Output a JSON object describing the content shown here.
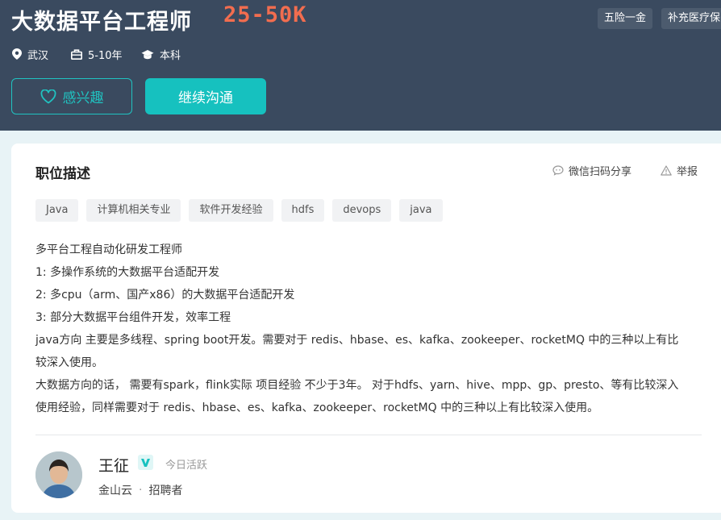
{
  "job": {
    "title": "大数据平台工程师",
    "salary": "25-50K",
    "benefits": [
      "五险一金",
      "补充医疗保险"
    ],
    "location": "武汉",
    "experience": "5-10年",
    "education": "本科"
  },
  "actions": {
    "interest_label": "感兴趣",
    "chat_label": "继续沟通"
  },
  "section": {
    "title": "职位描述",
    "share_label": "微信扫码分享",
    "report_label": "举报"
  },
  "tags": [
    "Java",
    "计算机相关专业",
    "软件开发经验",
    "hdfs",
    "devops",
    "java"
  ],
  "description": {
    "lines": [
      "多平台工程自动化研发工程师",
      "1: 多操作系统的大数据平台适配开发",
      "2: 多cpu（arm、国产x86）的大数据平台适配开发",
      "3: 部分大数据平台组件开发，效率工程",
      "java方向 主要是多线程、spring boot开发。需要对于 redis、hbase、es、kafka、zookeeper、rocketMQ 中的三种以上有比",
      "较深入使用。",
      "大数据方向的话， 需要有spark，flink实际 项目经验 不少于3年。 对于hdfs、yarn、hive、mpp、gp、presto、等有比较深入",
      "使用经验，同样需要对于 redis、hbase、es、kafka、zookeeper、rocketMQ 中的三种以上有比较深入使用。"
    ]
  },
  "recruiter": {
    "name": "王征",
    "active_status": "今日活跃",
    "company": "金山云",
    "role": "招聘者"
  },
  "colors": {
    "header_bg": "#3a4a5f",
    "salary": "#f26d4f",
    "accent": "#16c1bf"
  }
}
